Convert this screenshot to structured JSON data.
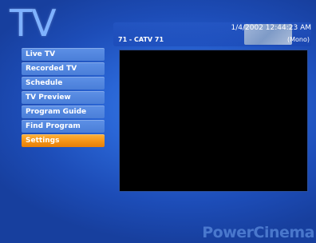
{
  "header": {
    "title": "TV",
    "datetime": "1/4/2002 12:44:23 AM",
    "channel": "71 - CATV 71",
    "audio_mode": "(Mono)"
  },
  "menu": {
    "items": [
      {
        "label": "Live TV"
      },
      {
        "label": "Recorded TV"
      },
      {
        "label": "Schedule"
      },
      {
        "label": "TV Preview"
      },
      {
        "label": "Program Guide"
      },
      {
        "label": "Find Program"
      },
      {
        "label": "Settings",
        "selected": true
      }
    ]
  },
  "branding": {
    "name": "PowerCinema"
  },
  "colors": {
    "accent_selected": "#f39113",
    "menu_item": "#4a7ed8",
    "background": "#2a66d6"
  }
}
